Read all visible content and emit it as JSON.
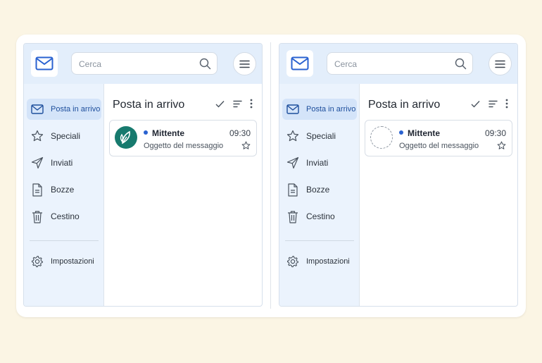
{
  "colors": {
    "background": "#fbf5e4",
    "topbar": "#e3eefb",
    "sidebar": "#ebf3fd",
    "active": "#d4e4f9",
    "accent": "#2a62d0",
    "avatar": "#177a6e"
  },
  "panels": [
    {
      "search": {
        "placeholder": "Cerca"
      },
      "nav": [
        {
          "label": "Posta in arrivo",
          "icon": "mail-icon",
          "active": true
        },
        {
          "label": "Speciali",
          "icon": "star-icon"
        },
        {
          "label": "Inviati",
          "icon": "send-icon"
        },
        {
          "label": "Bozze",
          "icon": "draft-icon"
        },
        {
          "label": "Cestino",
          "icon": "trash-icon"
        },
        {
          "label": "Impostazioni",
          "icon": "gear-icon"
        }
      ],
      "main": {
        "title": "Posta in arrivo"
      },
      "message": {
        "sender": "Mittente",
        "time": "09:30",
        "subject": "Oggetto del messaggio",
        "avatar": "leaf-avatar-icon",
        "unread": true
      }
    },
    {
      "search": {
        "placeholder": "Cerca"
      },
      "nav": [
        {
          "label": "Posta in arrivo",
          "icon": "mail-icon",
          "active": true
        },
        {
          "label": "Speciali",
          "icon": "star-icon"
        },
        {
          "label": "Inviati",
          "icon": "send-icon"
        },
        {
          "label": "Bozze",
          "icon": "draft-icon"
        },
        {
          "label": "Cestino",
          "icon": "trash-icon"
        },
        {
          "label": "Impostazioni",
          "icon": "gear-icon"
        }
      ],
      "main": {
        "title": "Posta in arrivo"
      },
      "message": {
        "sender": "Mittente",
        "time": "09:30",
        "subject": "Oggetto del messaggio",
        "avatar": "empty-avatar-placeholder",
        "unread": true
      }
    }
  ]
}
